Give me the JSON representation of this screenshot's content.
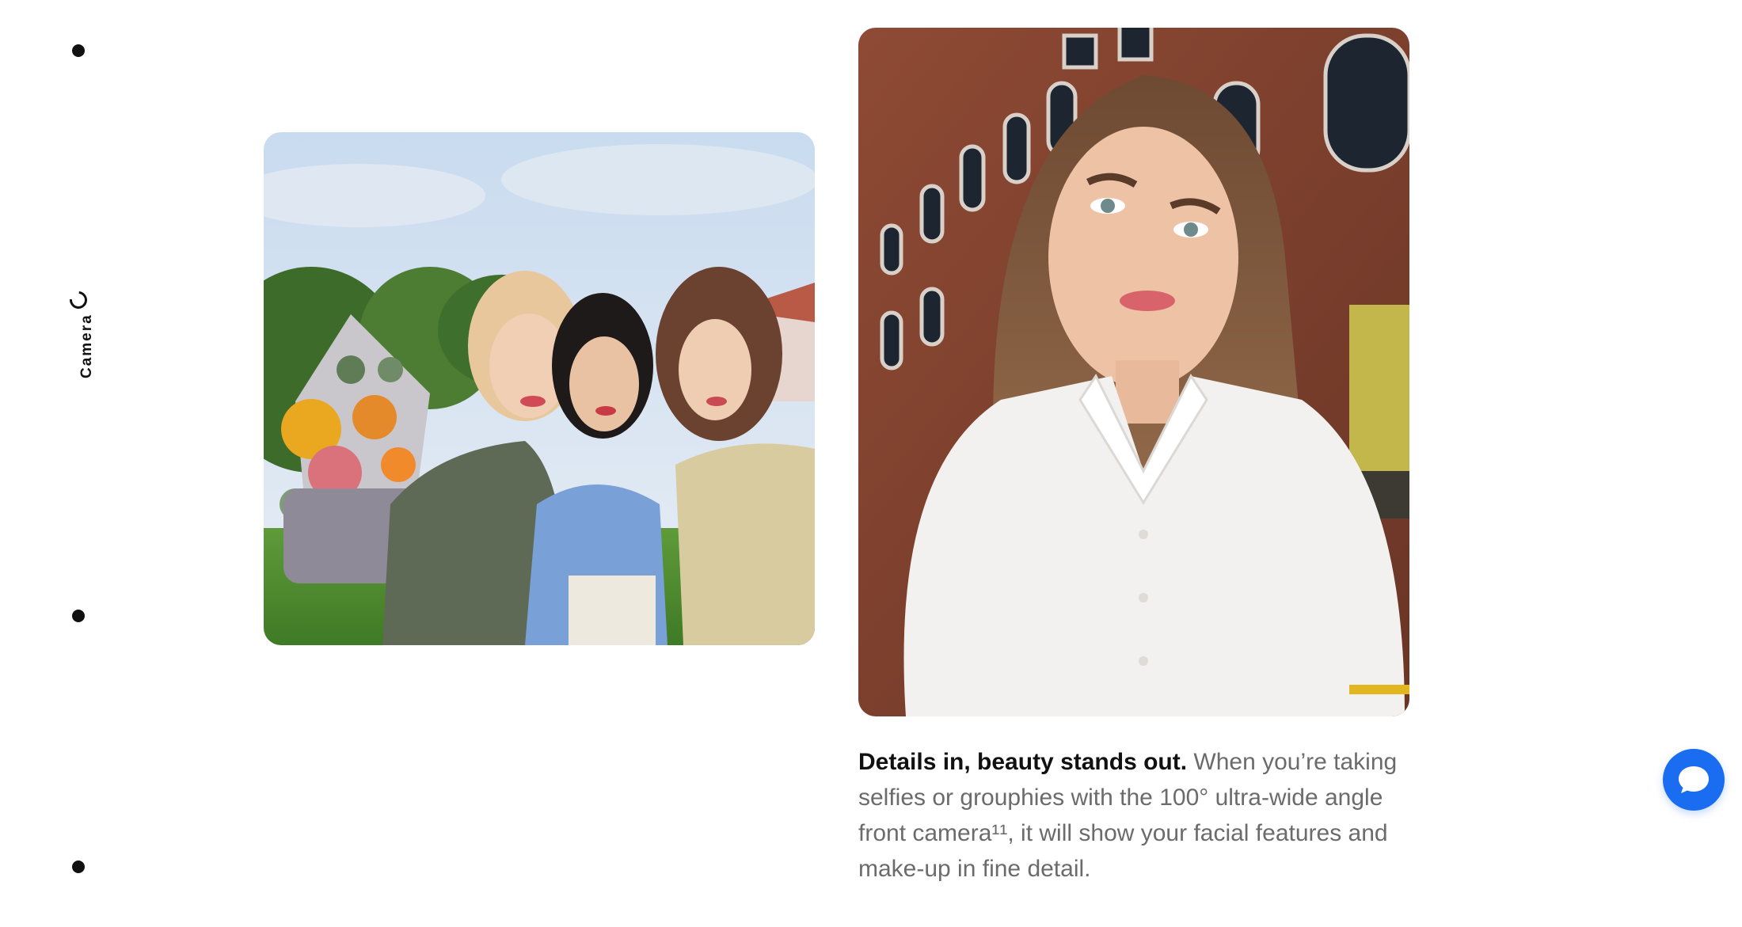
{
  "side_nav": {
    "active_label": "Camera",
    "items": [
      "section-1",
      "Camera",
      "section-3",
      "section-4"
    ]
  },
  "images": {
    "group_selfie": "group-selfie-photo",
    "portrait_selfie": "portrait-selfie-photo"
  },
  "caption": {
    "lead": "Details in, beauty stands out.",
    "body": " When you’re taking selfies or grouphies with the 100° ultra-wide angle front camera¹¹, it will show your facial features and make-up in fine detail."
  },
  "chat": {
    "icon": "chat-bubble-icon",
    "color": "#1a6cf0"
  }
}
